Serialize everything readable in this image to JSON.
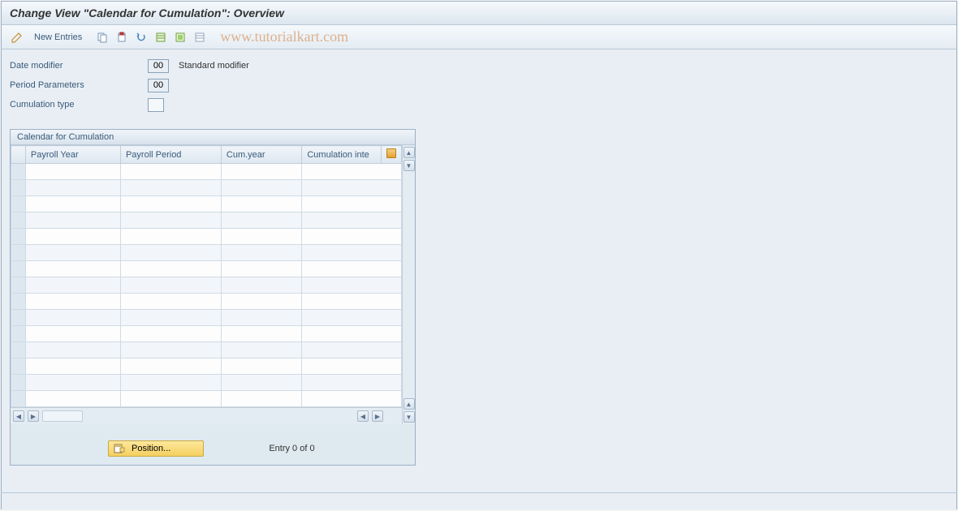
{
  "title": "Change View \"Calendar for Cumulation\": Overview",
  "toolbar": {
    "new_entries": "New Entries"
  },
  "watermark": "www.tutorialkart.com",
  "form": {
    "date_modifier_label": "Date modifier",
    "date_modifier_value": "00",
    "date_modifier_desc": "Standard modifier",
    "period_params_label": "Period Parameters",
    "period_params_value": "00",
    "cumulation_type_label": "Cumulation type",
    "cumulation_type_value": ""
  },
  "panel": {
    "title": "Calendar for Cumulation",
    "columns": {
      "c1": "Payroll Year",
      "c2": "Payroll Period",
      "c3": "Cum.year",
      "c4": "Cumulation inte"
    }
  },
  "footer": {
    "position_label": "Position...",
    "entry_text": "Entry 0 of 0"
  }
}
